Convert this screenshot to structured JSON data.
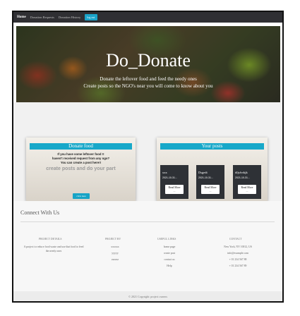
{
  "navbar": {
    "items": [
      "Home",
      "Donation Requests",
      "Donation History"
    ],
    "logout": "log out"
  },
  "hero": {
    "title": "Do_Donate",
    "subtitle_line1": "Donate the leftover food and feed the needy ones",
    "subtitle_line2": "Create posts so the NGO's near you will come to know about you"
  },
  "donate_card": {
    "heading": "Donate food",
    "line1": "If you have some leftover food !!",
    "line2": "haven't received request from any ngo?",
    "line3": "You can create a post here!!",
    "big": "create posts and do your part",
    "button": "click here"
  },
  "posts_card": {
    "heading": "Your posts",
    "posts": [
      {
        "title": "xxx",
        "date": "2021-10-31...",
        "button": "Read More",
        "sub": "—"
      },
      {
        "title": "Dsgedt",
        "date": "2021-10-31...",
        "button": "Read More",
        "sub": "—"
      },
      {
        "title": "dfjsfvrkjk",
        "date": "2021-10-31...",
        "button": "Read More",
        "sub": "—"
      }
    ]
  },
  "footer": {
    "connect": "Connect With Us",
    "columns": {
      "project_details": {
        "heading": "PROJECT DETAILS",
        "text": "A project to reduce food waste and use that food to feed the needy ones"
      },
      "project_by": {
        "heading": "PROJECT BY",
        "items": [
          "xxxxxx",
          "yyyyy",
          "zzzzzz"
        ]
      },
      "useful_links": {
        "heading": "USEFUL LINKS",
        "items": [
          "home page",
          "create post",
          "contact us",
          "Help"
        ]
      },
      "contact": {
        "heading": "CONTACT",
        "items": [
          "New York, NY 10012, US",
          "info@example.com",
          "+ 01 234 567 88",
          "+ 01 234 567 89"
        ]
      }
    },
    "copyright": "© 2021 Copyright: project owners"
  },
  "colors": {
    "accent": "#18a8c9",
    "navbar": "#2f2f33",
    "post_card": "#2e3136"
  }
}
